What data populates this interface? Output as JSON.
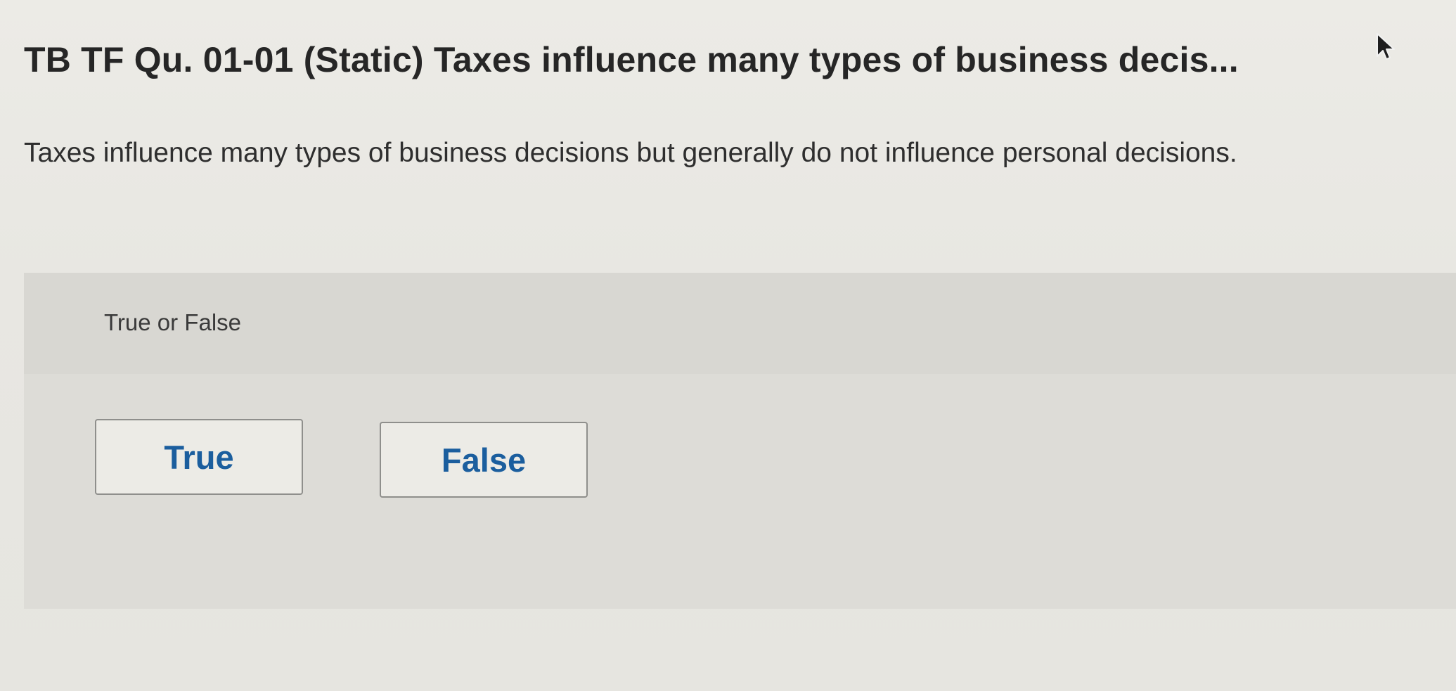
{
  "question": {
    "title": "TB TF Qu. 01-01 (Static) Taxes influence many types of business decis...",
    "prompt": "Taxes influence many types of business decisions but generally do not influence personal decisions."
  },
  "answer": {
    "type_label": "True or False",
    "choices": [
      {
        "label": "True"
      },
      {
        "label": "False"
      }
    ]
  },
  "colors": {
    "background": "#e9e8e3",
    "panel": "#dddcd7",
    "button_text": "#1b5e9e",
    "button_border": "#8f8f8c"
  },
  "icons": {
    "pointer": "mouse-pointer-icon"
  }
}
